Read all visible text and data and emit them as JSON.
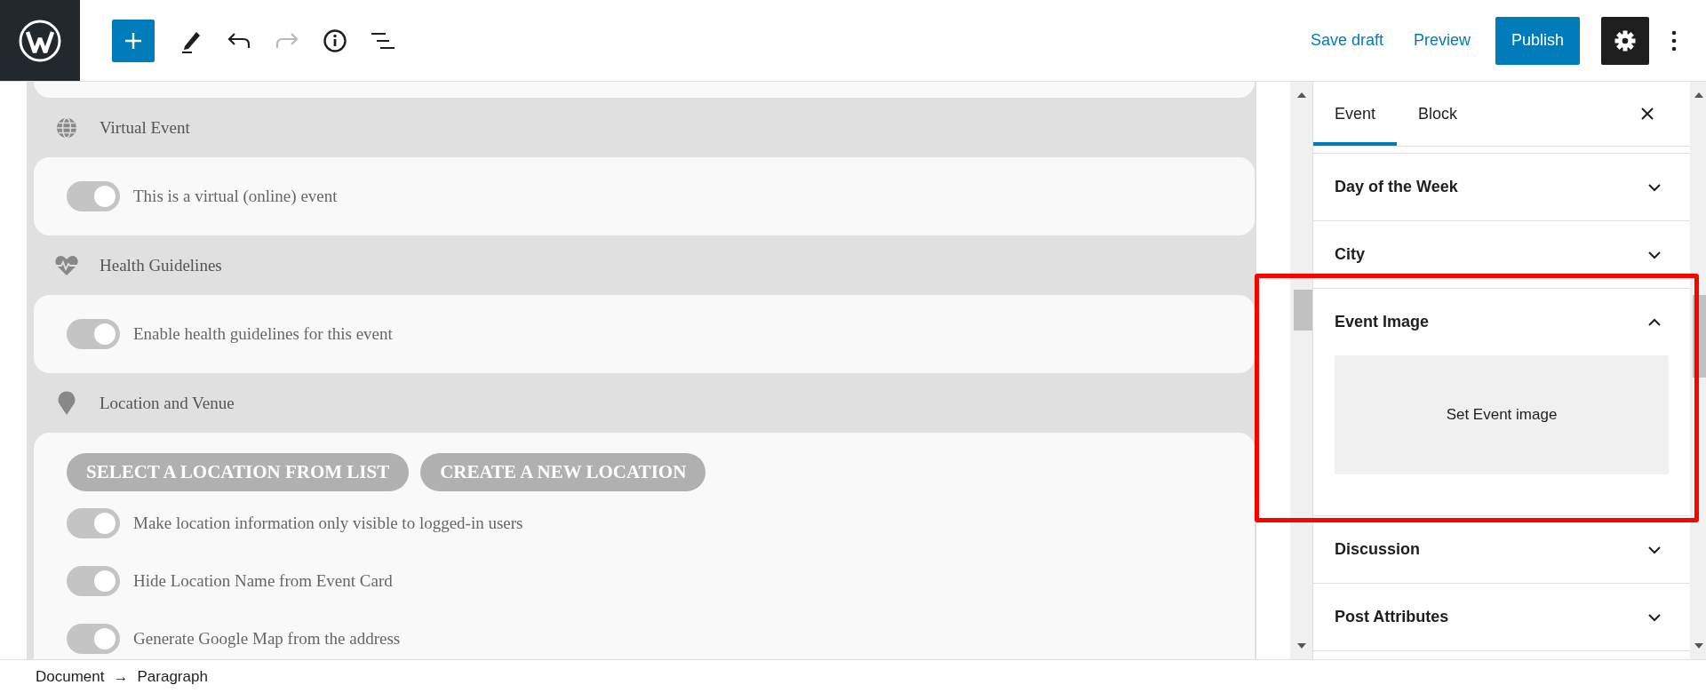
{
  "toolbar": {
    "save_draft": "Save draft",
    "preview": "Preview",
    "publish": "Publish",
    "redo_disabled": true,
    "settings_selected": true
  },
  "editor": {
    "sections": [
      {
        "title": "Virtual Event",
        "items": [
          {
            "kind": "toggle",
            "label": "This is a virtual (online) event",
            "on": true
          }
        ]
      },
      {
        "title": "Health Guidelines",
        "items": [
          {
            "kind": "toggle",
            "label": "Enable health guidelines for this event",
            "on": true
          }
        ]
      },
      {
        "title": "Location and Venue",
        "items": [
          {
            "kind": "buttons",
            "labels": [
              "SELECT A LOCATION FROM LIST",
              "CREATE A NEW LOCATION"
            ]
          },
          {
            "kind": "toggle",
            "label": "Make location information only visible to logged-in users",
            "on": true
          },
          {
            "kind": "toggle",
            "label": "Hide Location Name from Event Card",
            "on": true
          },
          {
            "kind": "toggle",
            "label": "Generate Google Map from the address",
            "on": true
          }
        ]
      }
    ]
  },
  "sidebar": {
    "tabs": [
      {
        "label": "Event",
        "selected": true
      },
      {
        "label": "Block",
        "selected": false
      }
    ],
    "panels": [
      {
        "title": "Day of the Week",
        "expanded": false
      },
      {
        "title": "City",
        "expanded": false
      },
      {
        "title": "Event Image",
        "expanded": true,
        "action": "Set Event image"
      },
      {
        "title": "Discussion",
        "expanded": false
      },
      {
        "title": "Post Attributes",
        "expanded": false
      }
    ]
  },
  "status_bar": {
    "breadcrumb": [
      "Document",
      "Paragraph"
    ],
    "separator": "→"
  }
}
